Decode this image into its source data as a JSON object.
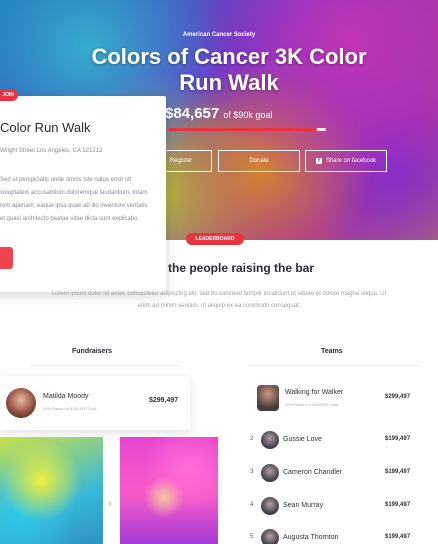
{
  "hero": {
    "org": "American Cancer Society",
    "title": "Colors of Cancer 3K Color Run Walk",
    "raised": "$84,657",
    "goal": "of $90k goal",
    "progress_fraction": 0.94,
    "buttons": {
      "register": "Register",
      "donate": "Donate",
      "share": "Share on facebook"
    }
  },
  "event_card": {
    "tag": "JOIN",
    "title": "Color Run Walk",
    "address": "Wright Street Los Angeles, CA 121212",
    "description": "Sed ut perspiciatis unde omnis iste natus error sit voluptatem accusantium doloremque laudantium, totam rem aperiam, eaque ipsa quae ab illo inventore veritatis et quasi architecto beatae vitae dicta sunt explicabo."
  },
  "leaderboard": {
    "badge": "LEADERBOARD",
    "heading": "the people raising the bar",
    "subtitle": "Lorem ipsum dolor sit amet, consectetur adipiscing elit, sed do eiusmod tempor incididunt ut labore et dolore magna aliqua. Ut enim ad minim veniam, ut aliquip ex ea commodo consequat.",
    "fundraisers_heading": "Fundraisers",
    "teams_heading": "Teams"
  },
  "top_fundraiser": {
    "name": "Matilda Moody",
    "meta": "30% Raised of $250,000 Goal",
    "amount": "$299,497"
  },
  "top_team": {
    "name": "Walking for Walker",
    "meta": "30% Raised of $250,000 Goal",
    "amount": "$299,497"
  },
  "teams": [
    {
      "rank": "2",
      "name": "Gussie Love",
      "amount": "$199,497"
    },
    {
      "rank": "3",
      "name": "Cameron Chandler",
      "amount": "$199,497"
    },
    {
      "rank": "4",
      "name": "Sean Murray",
      "amount": "$199,497"
    },
    {
      "rank": "5",
      "name": "Augusta Thornton",
      "amount": "$199,497"
    }
  ],
  "colors": {
    "accent_red": "#e8343f",
    "text_dark": "#2a2a35",
    "text_muted": "#8a8a95"
  }
}
